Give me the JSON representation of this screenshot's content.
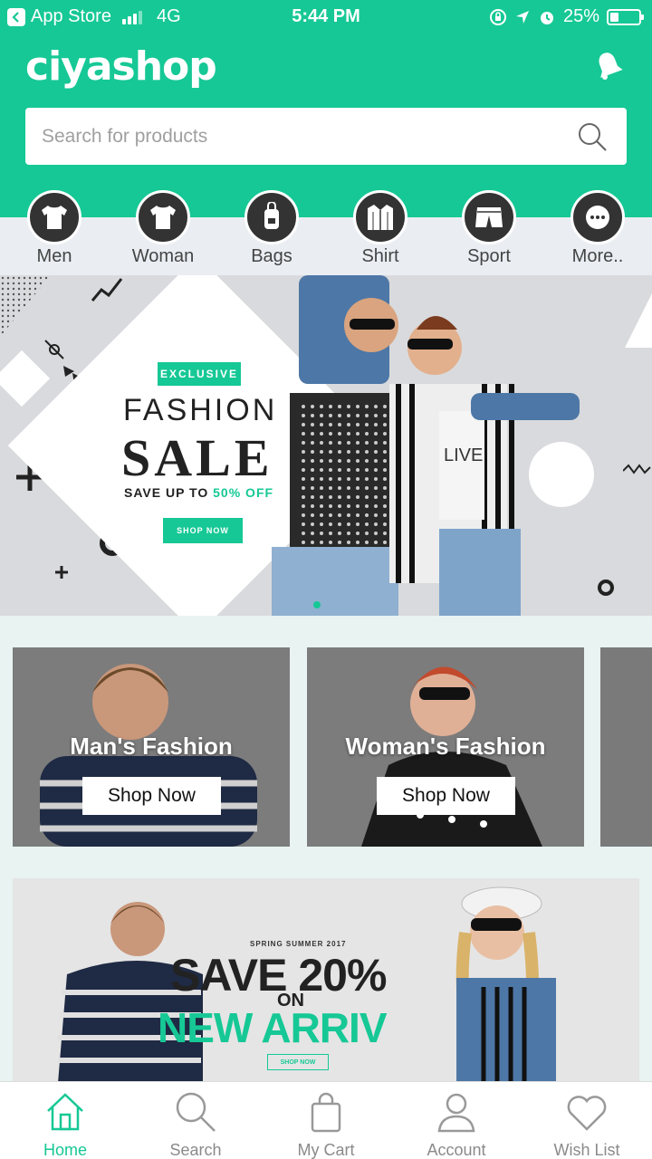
{
  "status_bar": {
    "back_app": "App Store",
    "network": "4G",
    "time": "5:44 PM",
    "battery": "25%"
  },
  "header": {
    "logo": "ciyashop",
    "search_placeholder": "Search for products"
  },
  "categories": [
    {
      "label": "Men",
      "icon": "tshirt-icon"
    },
    {
      "label": "Woman",
      "icon": "tshirt-icon"
    },
    {
      "label": "Bags",
      "icon": "backpack-icon"
    },
    {
      "label": "Shirt",
      "icon": "shirt-icon"
    },
    {
      "label": "Sport",
      "icon": "shorts-icon"
    },
    {
      "label": "More..",
      "icon": "more-dots-icon"
    }
  ],
  "hero_banner": {
    "badge": "EXCLUSIVE",
    "line1": "FASHION",
    "line2": "SALE",
    "line3_prefix": "SAVE UP TO ",
    "line3_highlight": "50% OFF",
    "button": "SHOP NOW"
  },
  "fashion_cards": [
    {
      "title": "Man's Fashion",
      "button": "Shop Now"
    },
    {
      "title": "Woman's Fashion",
      "button": "Shop Now"
    }
  ],
  "promo_banner": {
    "season": "SPRING SUMMER 2017",
    "headline": "SAVE 20%",
    "on": "ON",
    "subline": "NEW ARRIV",
    "button": "SHOP NOW"
  },
  "bottom_nav": [
    {
      "label": "Home",
      "icon": "home-icon",
      "active": true
    },
    {
      "label": "Search",
      "icon": "search-icon",
      "active": false
    },
    {
      "label": "My Cart",
      "icon": "cart-icon",
      "active": false
    },
    {
      "label": "Account",
      "icon": "account-icon",
      "active": false
    },
    {
      "label": "Wish List",
      "icon": "heart-icon",
      "active": false
    }
  ],
  "colors": {
    "accent": "#16c895",
    "dark_icon": "#333333",
    "nav_text": "#8a8a8a"
  }
}
